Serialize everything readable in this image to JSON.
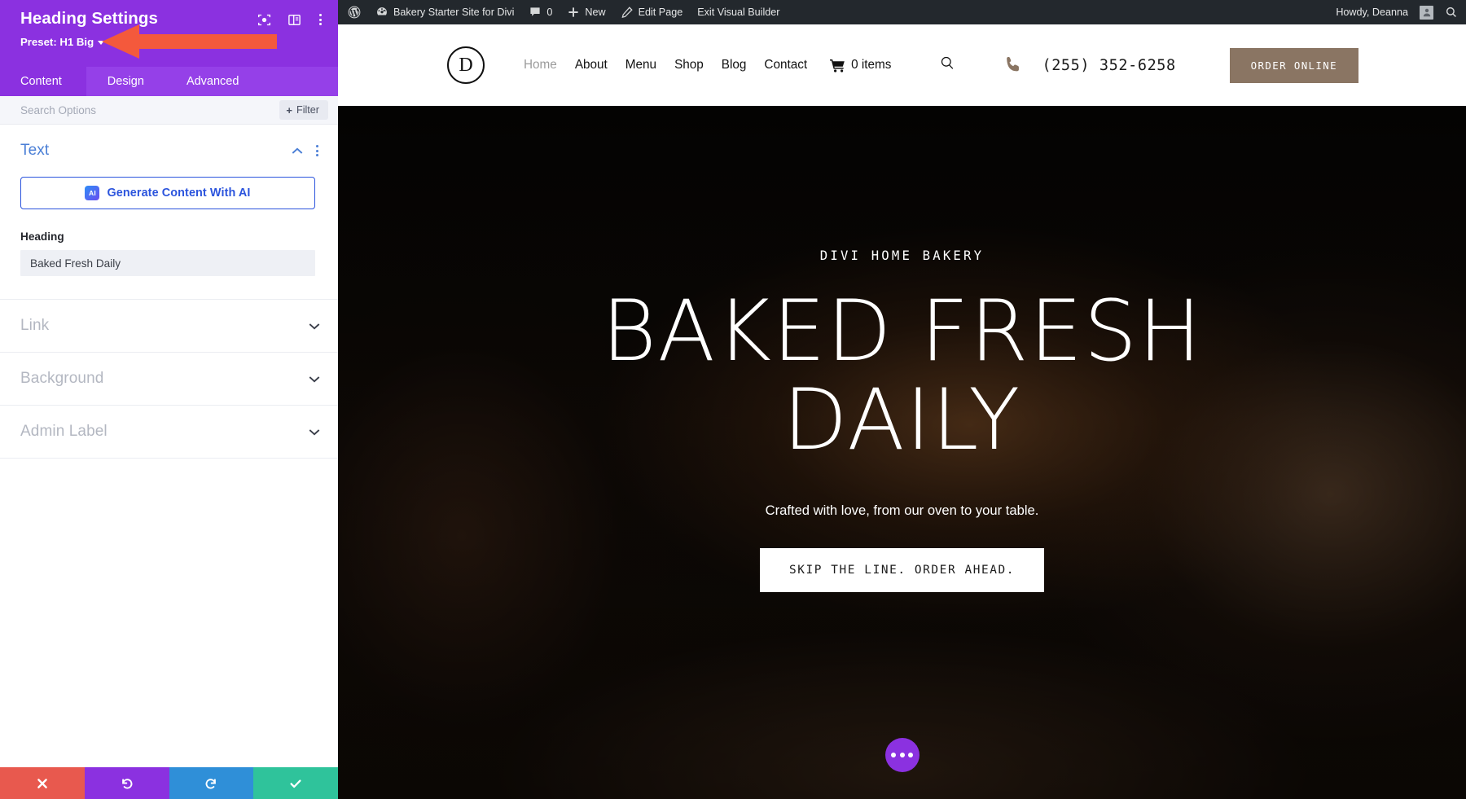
{
  "settings_panel": {
    "title": "Heading Settings",
    "preset_label": "Preset: H1 Big",
    "header_icons": [
      {
        "name": "focus-icon"
      },
      {
        "name": "layout-panel-icon"
      },
      {
        "name": "kebab-menu-icon"
      }
    ],
    "tabs": [
      {
        "label": "Content",
        "active": true
      },
      {
        "label": "Design",
        "active": false
      },
      {
        "label": "Advanced",
        "active": false
      }
    ],
    "search_placeholder": "Search Options",
    "filter_label": "Filter",
    "sections": [
      {
        "label": "Text",
        "open": true
      },
      {
        "label": "Link",
        "open": false
      },
      {
        "label": "Background",
        "open": false
      },
      {
        "label": "Admin Label",
        "open": false
      }
    ],
    "ai_button_label": "Generate Content With AI",
    "ai_badge_text": "AI",
    "heading_field_label": "Heading",
    "heading_field_value": "Baked Fresh Daily",
    "actions": [
      {
        "name": "cancel",
        "icon": "close-icon",
        "color": "#e8594e"
      },
      {
        "name": "undo",
        "icon": "undo-icon",
        "color": "#8B31E0"
      },
      {
        "name": "redo",
        "icon": "redo-icon",
        "color": "#2f8fd8"
      },
      {
        "name": "save",
        "icon": "check-icon",
        "color": "#2fc39b"
      }
    ],
    "accent_color": "#8B31E0",
    "tab_bar_color": "#9540E8"
  },
  "annotation": {
    "arrow_color": "#f4593c",
    "points_to": "preset-selector"
  },
  "admin_bar": {
    "wp_logo": "wordpress-icon",
    "site_name": "Bakery Starter Site for Divi",
    "comments_count": "0",
    "new_label": "New",
    "edit_page_label": "Edit Page",
    "exit_builder_label": "Exit Visual Builder",
    "greeting": "Howdy, Deanna",
    "search_icon": "search-icon",
    "background": "#23282d"
  },
  "site_header": {
    "logo_letter": "D",
    "nav": [
      {
        "label": "Home",
        "current": true
      },
      {
        "label": "About",
        "current": false
      },
      {
        "label": "Menu",
        "current": false
      },
      {
        "label": "Shop",
        "current": false
      },
      {
        "label": "Blog",
        "current": false
      },
      {
        "label": "Contact",
        "current": false
      }
    ],
    "cart_label": "0 items",
    "search_icon": "search-icon",
    "phone_icon": "phone-icon",
    "phone": "(255) 352-6258",
    "order_button": "ORDER ONLINE",
    "order_button_color": "#8a7563"
  },
  "hero": {
    "eyebrow": "DIVI HOME BAKERY",
    "title": "Baked Fresh Daily",
    "subtitle": "Crafted with love, from our oven to your table.",
    "cta_label": "SKIP THE LINE. ORDER AHEAD.",
    "fab_icon": "ellipsis-icon"
  }
}
